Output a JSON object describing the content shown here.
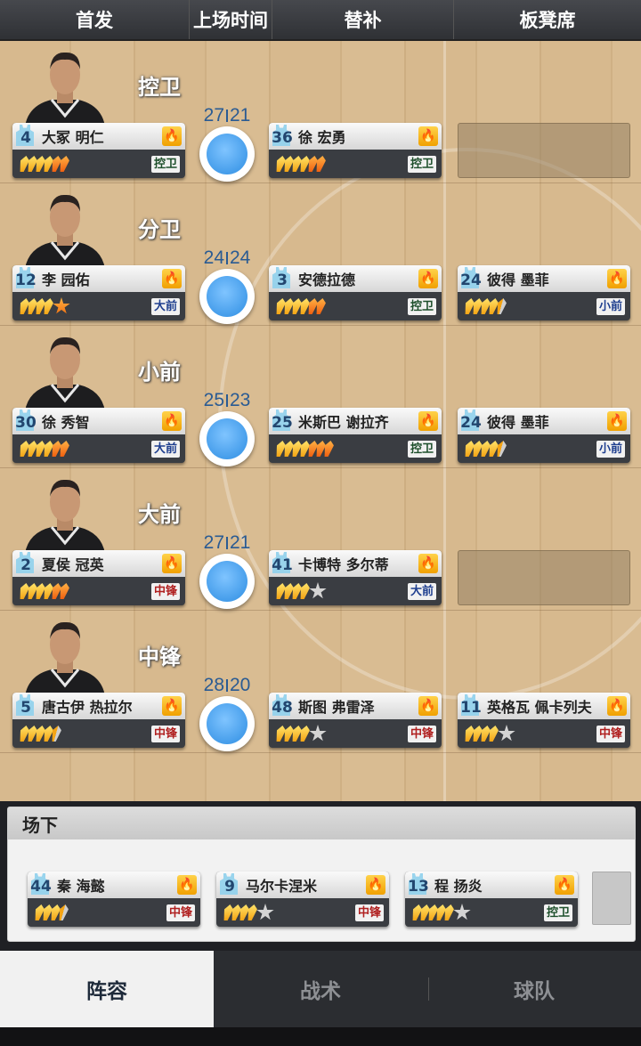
{
  "header": {
    "tabs": [
      "首发",
      "上场时间",
      "替补",
      "板凳席"
    ]
  },
  "rows": [
    {
      "position": "控卫",
      "minutes": {
        "starter": "27",
        "sub": "21"
      },
      "starter": {
        "number": "4",
        "name": "大冢 明仁",
        "badge": "控卫",
        "badge_type": "pg",
        "stars": "yyyyoo"
      },
      "sub": {
        "number": "36",
        "name": "徐 宏勇",
        "badge": "控卫",
        "badge_type": "pg",
        "stars": "yyyyoo"
      },
      "reserve": null
    },
    {
      "position": "分卫",
      "minutes": {
        "starter": "24",
        "sub": "24"
      },
      "starter": {
        "number": "12",
        "name": "李 园佑",
        "badge": "大前",
        "badge_type": "pf",
        "stars": "yyyyO"
      },
      "sub": {
        "number": "3",
        "name": "安德拉德",
        "badge": "控卫",
        "badge_type": "pg",
        "stars": "yyyyoo"
      },
      "reserve": {
        "number": "24",
        "name": "彼得 墨菲",
        "badge": "小前",
        "badge_type": "sf",
        "stars": "yyyyh"
      }
    },
    {
      "position": "小前",
      "minutes": {
        "starter": "25",
        "sub": "23"
      },
      "starter": {
        "number": "30",
        "name": "徐 秀智",
        "badge": "大前",
        "badge_type": "pf",
        "stars": "yyyyoo"
      },
      "sub": {
        "number": "25",
        "name": "米斯巴 谢拉齐",
        "badge": "控卫",
        "badge_type": "pg",
        "stars": "yyyyooo"
      },
      "reserve": {
        "number": "24",
        "name": "彼得 墨菲",
        "badge": "小前",
        "badge_type": "sf",
        "stars": "yyyyh"
      }
    },
    {
      "position": "大前",
      "minutes": {
        "starter": "27",
        "sub": "21"
      },
      "starter": {
        "number": "2",
        "name": "夏侯 冠英",
        "badge": "中锋",
        "badge_type": "c",
        "stars": "yyyyoo"
      },
      "sub": {
        "number": "41",
        "name": "卡博特 多尔蒂",
        "badge": "大前",
        "badge_type": "pf",
        "stars": "yyyyG"
      },
      "reserve": null
    },
    {
      "position": "中锋",
      "minutes": {
        "starter": "28",
        "sub": "20"
      },
      "starter": {
        "number": "5",
        "name": "唐古伊 热拉尔",
        "badge": "中锋",
        "badge_type": "c",
        "stars": "yyyyh"
      },
      "sub": {
        "number": "48",
        "name": "斯图 弗雷泽",
        "badge": "中锋",
        "badge_type": "c",
        "stars": "yyyyG"
      },
      "reserve": {
        "number": "11",
        "name": "英格瓦 佩卡列夫",
        "badge": "中锋",
        "badge_type": "c",
        "stars": "yyyyG"
      }
    }
  ],
  "bench": {
    "title": "场下",
    "players": [
      {
        "number": "44",
        "name": "秦 海懿",
        "badge": "中锋",
        "badge_type": "c",
        "stars": "yyyh"
      },
      {
        "number": "9",
        "name": "马尔卡涅米",
        "badge": "中锋",
        "badge_type": "c",
        "stars": "yyyyG"
      },
      {
        "number": "13",
        "name": "程 扬炎",
        "badge": "控卫",
        "badge_type": "pg",
        "stars": "yyyyyG"
      }
    ]
  },
  "tabs": {
    "items": [
      "阵容",
      "战术",
      "球队"
    ],
    "active": 0
  },
  "colors": {
    "accent_blue": "#2a5b93",
    "fire": "#f0a000",
    "active_tab_bg": "#f1f1f1"
  },
  "icons": {
    "fire": "fire-icon",
    "clock": "minutes-clock-icon",
    "jersey": "jersey-icon",
    "star": "star-icon"
  }
}
